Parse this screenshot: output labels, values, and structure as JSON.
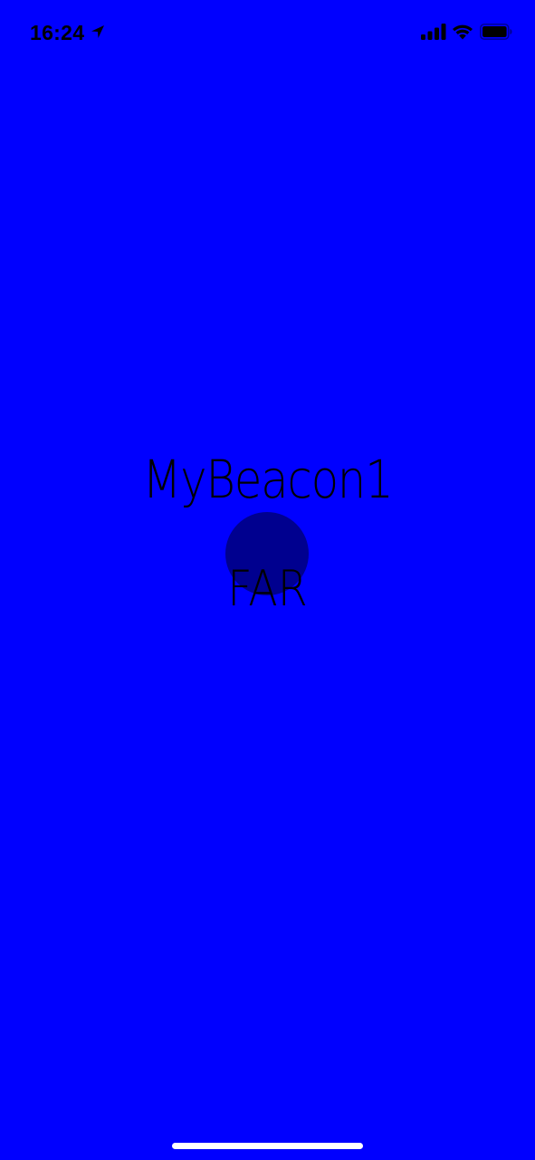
{
  "colors": {
    "background": "#0000FF",
    "text": "#000000",
    "circle": "#00008F",
    "status_bar_foreground": "#000000",
    "home_indicator": "#FFFFFF"
  },
  "status_bar": {
    "time": "16:24",
    "icons": [
      "location-arrow-icon",
      "cellular-signal-icon",
      "wifi-icon",
      "battery-icon"
    ]
  },
  "beacon": {
    "name": "MyBeacon1",
    "proximity": "FAR"
  }
}
